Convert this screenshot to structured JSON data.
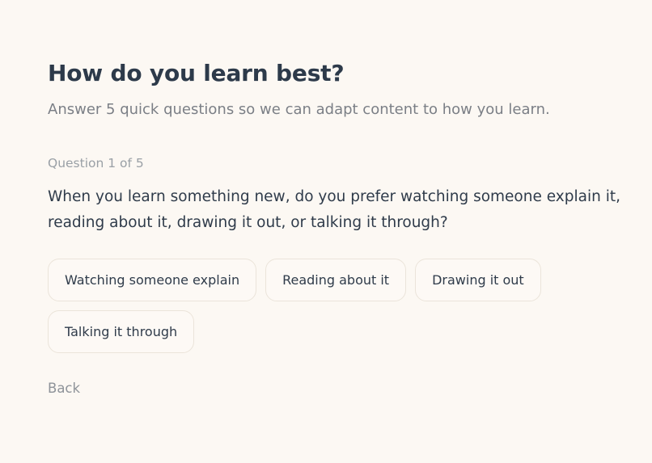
{
  "header": {
    "title": "How do you learn best?",
    "subtitle": "Answer 5 quick questions so we can adapt content to how you learn."
  },
  "quiz": {
    "progress_label": "Question 1 of 5",
    "current_question": 1,
    "total_questions": 5,
    "question_text": "When you learn something new, do you prefer watching someone explain it, reading about it, drawing it out, or talking it through?",
    "options": [
      {
        "label": "Watching someone explain"
      },
      {
        "label": "Reading about it"
      },
      {
        "label": "Drawing it out"
      },
      {
        "label": "Talking it through"
      }
    ]
  },
  "nav": {
    "back_label": "Back"
  },
  "colors": {
    "background": "#fcf8f3",
    "heading": "#2d3a4a",
    "muted_text": "#7b7f86",
    "option_border": "#ebe4da"
  }
}
